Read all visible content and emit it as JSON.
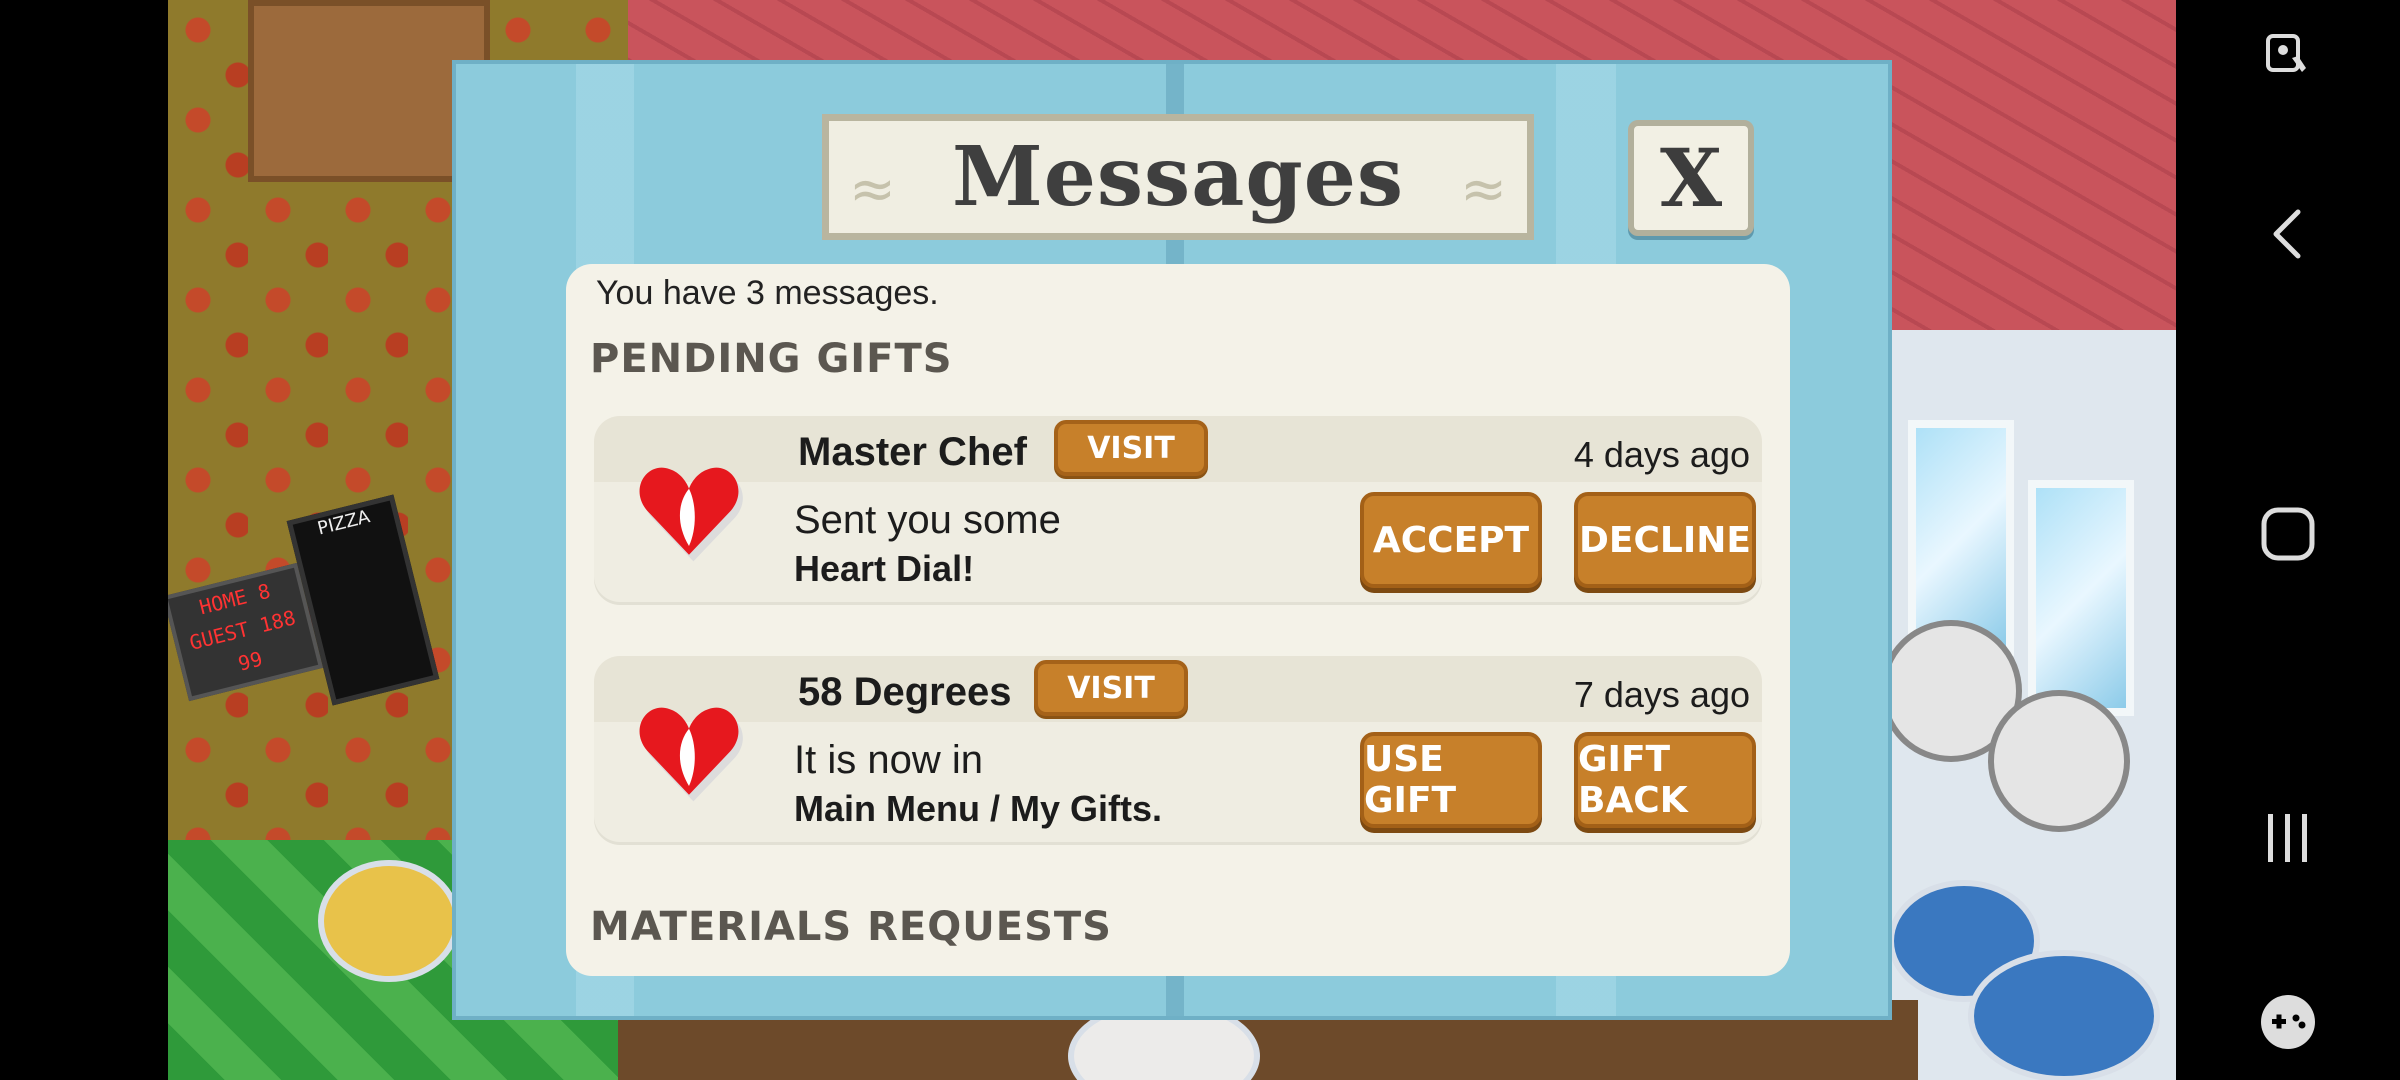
{
  "dialog": {
    "title": "Messages",
    "close_label": "X",
    "summary": "You have 3 messages.",
    "sections": {
      "pending": "PENDING GIFTS",
      "materials": "MATERIALS REQUESTS"
    },
    "messages": [
      {
        "sender": "Master Chef",
        "visit_label": "VISIT",
        "age": "4 days ago",
        "line1": "Sent you some",
        "line2": "Heart Dial!",
        "primary_label": "ACCEPT",
        "secondary_label": "DECLINE",
        "icon": "heart-icon"
      },
      {
        "sender": "58 Degrees",
        "visit_label": "VISIT",
        "age": "7 days ago",
        "line1": "It is now in",
        "line2": "Main Menu / My Gifts.",
        "primary_label": "USE GIFT",
        "secondary_label": "GIFT BACK",
        "icon": "heart-icon"
      }
    ]
  },
  "scene": {
    "scoreboard_text": "HOME 8 GUEST 188 99",
    "sign_text": "PIZZA"
  },
  "navbar": {
    "icons": [
      "screen-lock-icon",
      "back-icon",
      "home-icon",
      "recents-icon",
      "game-launcher-icon"
    ]
  },
  "colors": {
    "dialog_bg": "#8ccbdc",
    "panel_bg": "#f4f2e8",
    "button_orange": "#c7802a"
  }
}
